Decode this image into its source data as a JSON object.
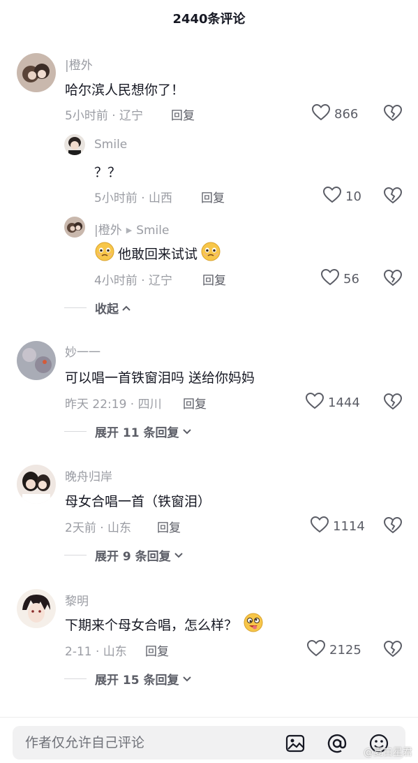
{
  "header": {
    "title": "2440条评论"
  },
  "comments": [
    {
      "username": "|橙外",
      "text": "哈尔滨人民想你了！",
      "meta": "5小时前 · 辽宁",
      "reply_label": "回复",
      "likes": "866"
    },
    {
      "username": "Smile",
      "text": "？？",
      "meta": "5小时前 · 山西",
      "reply_label": "回复",
      "likes": "10"
    },
    {
      "username": "|橙外",
      "reply_to": "Smile",
      "text": "他敢回来试试",
      "meta": "4小时前 · 辽宁",
      "reply_label": "回复",
      "likes": "56"
    },
    {
      "username": "妙一一",
      "text": "可以唱一首铁窗泪吗 送给你妈妈",
      "meta": "昨天 22:19 · 四川",
      "reply_label": "回复",
      "likes": "1444"
    },
    {
      "username": "晚舟归岸",
      "text": "母女合唱一首（铁窗泪）",
      "meta": "2天前 · 山东",
      "reply_label": "回复",
      "likes": "1114"
    },
    {
      "username": "黎明",
      "text": "下期来个母女合唱，怎么样？",
      "meta": "2-11 · 山东",
      "reply_label": "回复",
      "likes": "2125"
    }
  ],
  "collapse_label": "收起",
  "expand_labels": [
    "展开 11 条回复",
    "展开 9 条回复",
    "展开 15 条回复"
  ],
  "footer": {
    "input_placeholder": "作者仅允许自己评论"
  },
  "watermark": "@夏白星君",
  "icons": {
    "like": "heart-outline-icon",
    "dislike": "broken-heart-icon",
    "image": "image-icon",
    "mention": "at-icon",
    "emoji": "emoji-icon"
  },
  "colors": {
    "text": "#161823",
    "muted": "#9a9ca3",
    "action": "#5b5d66"
  }
}
